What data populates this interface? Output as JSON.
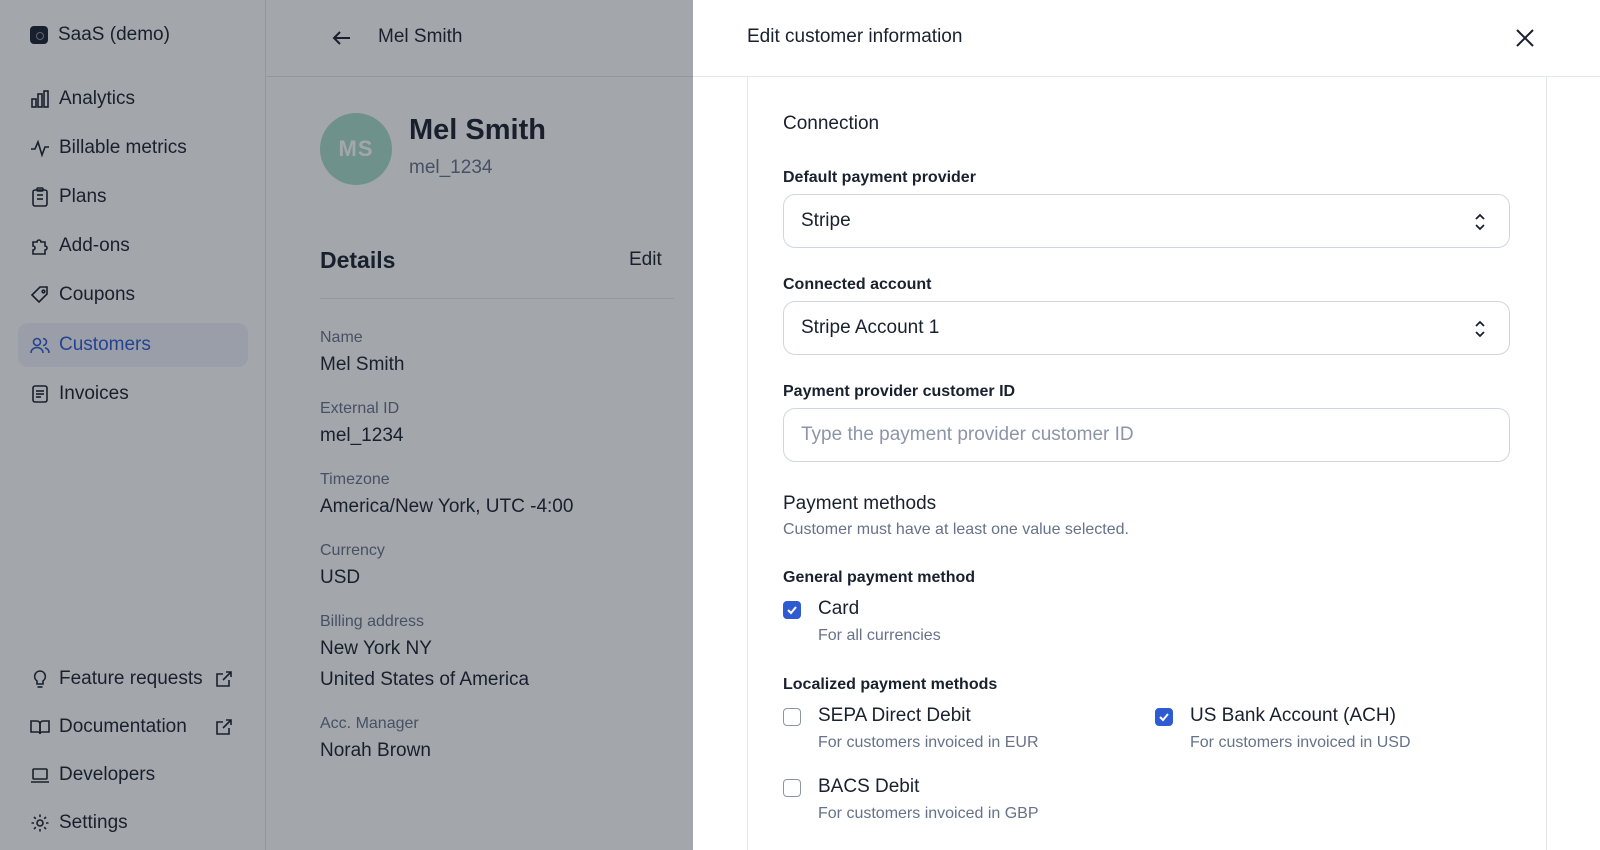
{
  "sidebar": {
    "org_name": "SaaS (demo)",
    "nav": [
      {
        "label": "Analytics",
        "icon": "bar-chart-icon"
      },
      {
        "label": "Billable metrics",
        "icon": "pulse-icon"
      },
      {
        "label": "Plans",
        "icon": "clipboard-icon"
      },
      {
        "label": "Add-ons",
        "icon": "puzzle-icon"
      },
      {
        "label": "Coupons",
        "icon": "tag-icon"
      },
      {
        "label": "Customers",
        "icon": "users-icon",
        "active": true
      },
      {
        "label": "Invoices",
        "icon": "receipt-icon"
      }
    ],
    "bottom": [
      {
        "label": "Feature requests",
        "icon": "lightbulb-icon",
        "external": true
      },
      {
        "label": "Documentation",
        "icon": "book-icon",
        "external": true
      },
      {
        "label": "Developers",
        "icon": "laptop-icon"
      },
      {
        "label": "Settings",
        "icon": "gear-icon"
      }
    ]
  },
  "page": {
    "title": "Mel Smith",
    "avatar_initials": "MS",
    "customer_name": "Mel Smith",
    "customer_external_id": "mel_1234",
    "details_title": "Details",
    "edit_label": "Edit",
    "fields": [
      {
        "label": "Name",
        "value": "Mel Smith"
      },
      {
        "label": "External ID",
        "value": "mel_1234"
      },
      {
        "label": "Timezone",
        "value": "America/New York, UTC -4:00"
      },
      {
        "label": "Currency",
        "value": "USD"
      },
      {
        "label": "Billing address",
        "value": "New York NY",
        "value2": "United States of America"
      },
      {
        "label": "Acc. Manager",
        "value": "Norah Brown"
      }
    ]
  },
  "drawer": {
    "title": "Edit customer information",
    "connection_title": "Connection",
    "default_provider_label": "Default payment provider",
    "default_provider_value": "Stripe",
    "connected_account_label": "Connected account",
    "connected_account_value": "Stripe Account 1",
    "provider_customer_id_label": "Payment provider customer ID",
    "provider_customer_id_placeholder": "Type the payment provider customer ID",
    "payment_methods_title": "Payment methods",
    "payment_methods_help": "Customer must have at least one value selected.",
    "general_label": "General payment method",
    "card": {
      "label": "Card",
      "desc": "For all currencies",
      "checked": true
    },
    "localized_label": "Localized payment methods",
    "sepa": {
      "label": "SEPA Direct Debit",
      "desc": "For customers invoiced in EUR",
      "checked": false
    },
    "ach": {
      "label": "US Bank Account (ACH)",
      "desc": "For customers invoiced in USD",
      "checked": true
    },
    "bacs": {
      "label": "BACS Debit",
      "desc": "For customers invoiced in GBP",
      "checked": false
    }
  },
  "colors": {
    "accent": "#2f5bd2",
    "avatar_bg": "#a7dccc",
    "overlay": "rgba(25,33,46,0.4)"
  }
}
